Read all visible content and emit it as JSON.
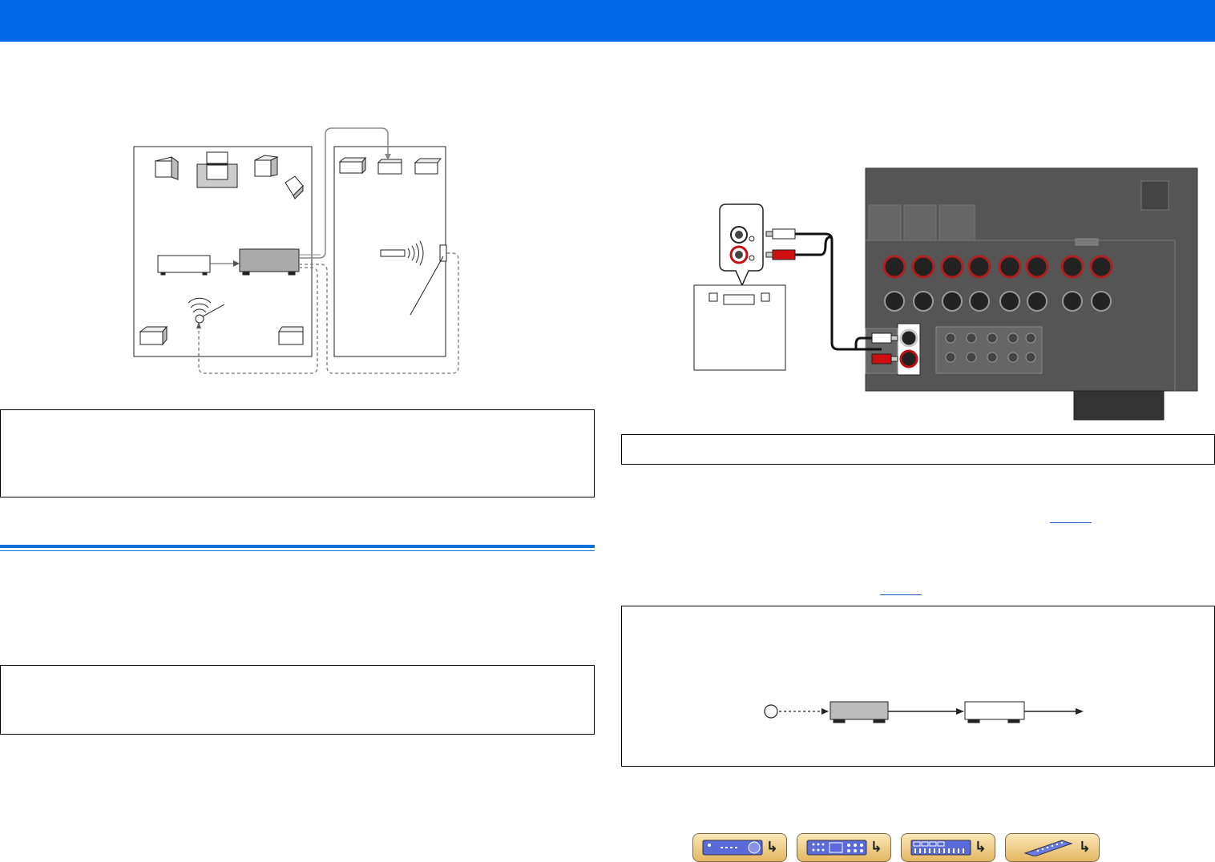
{
  "page": {
    "header_color": "#0068e4",
    "link_color": "#1a56c8"
  },
  "diagrams": {
    "zone_layout": {
      "description_text": ""
    },
    "rear_panel_connection": {},
    "remote_chain": {}
  },
  "nav_buttons": [
    {
      "icon": "front-panel-icon"
    },
    {
      "icon": "rear-panel-icon"
    },
    {
      "icon": "on-screen-menu-icon"
    },
    {
      "icon": "remote-control-icon"
    }
  ]
}
